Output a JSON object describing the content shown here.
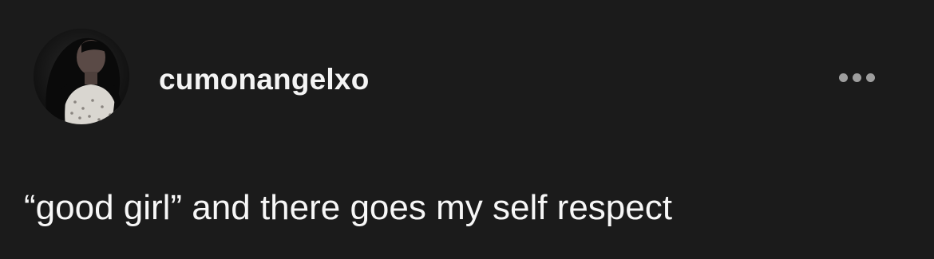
{
  "post": {
    "author": {
      "username": "cumonangelxo"
    },
    "menu": {
      "icon": "more-horizontal-icon"
    },
    "body_text": "“good girl” and there goes my self respect"
  },
  "colors": {
    "background": "#1b1b1b",
    "text": "#ffffff",
    "menu_dots": "#9e9e9e"
  }
}
